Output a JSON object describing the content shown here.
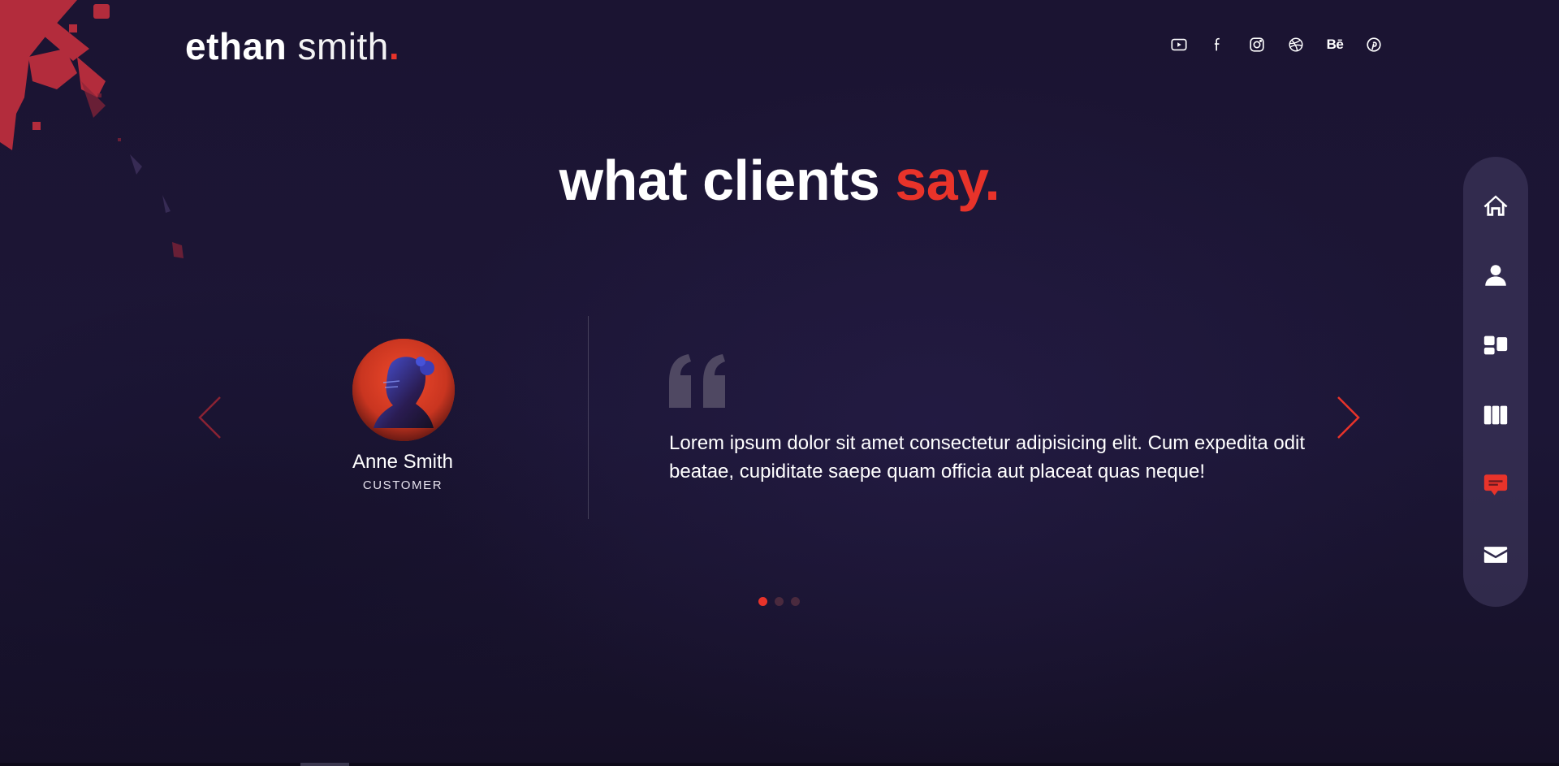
{
  "brand": {
    "first": "ethan",
    "last": " smith",
    "dot": "."
  },
  "colors": {
    "accent": "#e8332a",
    "background": "#1b1530",
    "nav_bg": "#463e64"
  },
  "social": [
    {
      "icon": "youtube-icon"
    },
    {
      "icon": "facebook-icon"
    },
    {
      "icon": "instagram-icon"
    },
    {
      "icon": "dribbble-icon"
    },
    {
      "icon": "behance-icon",
      "text": "Bē"
    },
    {
      "icon": "pinterest-icon"
    }
  ],
  "section": {
    "title_main": "what clients ",
    "title_accent": "say."
  },
  "testimonial": {
    "name": "Anne Smith",
    "role": "CUSTOMER",
    "quote": "Lorem ipsum dolor sit amet consectetur adipisicing elit. Cum expedita odit beatae, cupiditate saepe quam officia aut placeat quas neque!"
  },
  "pagination": {
    "count": 3,
    "active": 1
  },
  "nav": [
    {
      "icon": "home-icon",
      "active": false
    },
    {
      "icon": "user-icon",
      "active": false
    },
    {
      "icon": "services-icon",
      "active": false
    },
    {
      "icon": "work-icon",
      "active": false
    },
    {
      "icon": "testimonials-icon",
      "active": true
    },
    {
      "icon": "mail-icon",
      "active": false
    }
  ]
}
